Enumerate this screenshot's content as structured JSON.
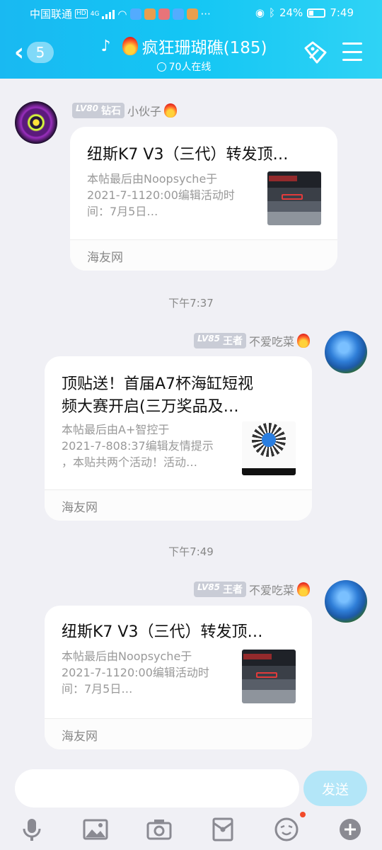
{
  "status_bar": {
    "carrier": "中国联通",
    "hd": "HD",
    "network": "4G",
    "more": "···",
    "battery": "24%",
    "time": "7:49"
  },
  "header": {
    "unread_count": "5",
    "title": "疯狂珊瑚礁(185)",
    "online": "70人在线"
  },
  "messages": [
    {
      "level": "LV80",
      "rank": "钻石",
      "name": "小伙子",
      "card": {
        "title": "纽斯K7 V3（三代）转发顶…",
        "desc": [
          "本帖最后由Noopsyche于",
          "2021-7-1120:00编辑活动时",
          "间：7月5日…"
        ],
        "source": "海友网"
      }
    },
    {
      "time": "下午7:37",
      "level": "LV85",
      "rank": "王者",
      "name": "不爱吃菜",
      "card": {
        "title": [
          "顶贴送！首届A7杯海缸短视",
          "频大赛开启(三万奖品及…"
        ],
        "desc": [
          "本帖最后由A+智控于",
          "2021-7-808:37编辑友情提示",
          "，本贴共两个活动！活动…"
        ],
        "source": "海友网"
      }
    },
    {
      "time": "下午7:49",
      "level": "LV85",
      "rank": "王者",
      "name": "不爱吃菜",
      "card": {
        "title": "纽斯K7 V3（三代）转发顶…",
        "desc": [
          "本帖最后由Noopsyche于",
          "2021-7-1120:00编辑活动时",
          "间：7月5日…"
        ],
        "source": "海友网"
      }
    }
  ],
  "input": {
    "placeholder": "",
    "send_label": "发送"
  },
  "toolbar": [
    "microphone-icon",
    "image-icon",
    "camera-icon",
    "red-packet-icon",
    "emoji-icon",
    "plus-icon"
  ],
  "colors": {
    "header_start": "#19b9f2",
    "header_end": "#2fd3f5",
    "send_button": "#b3e6f8",
    "notification_dot": "#f24a2a"
  }
}
